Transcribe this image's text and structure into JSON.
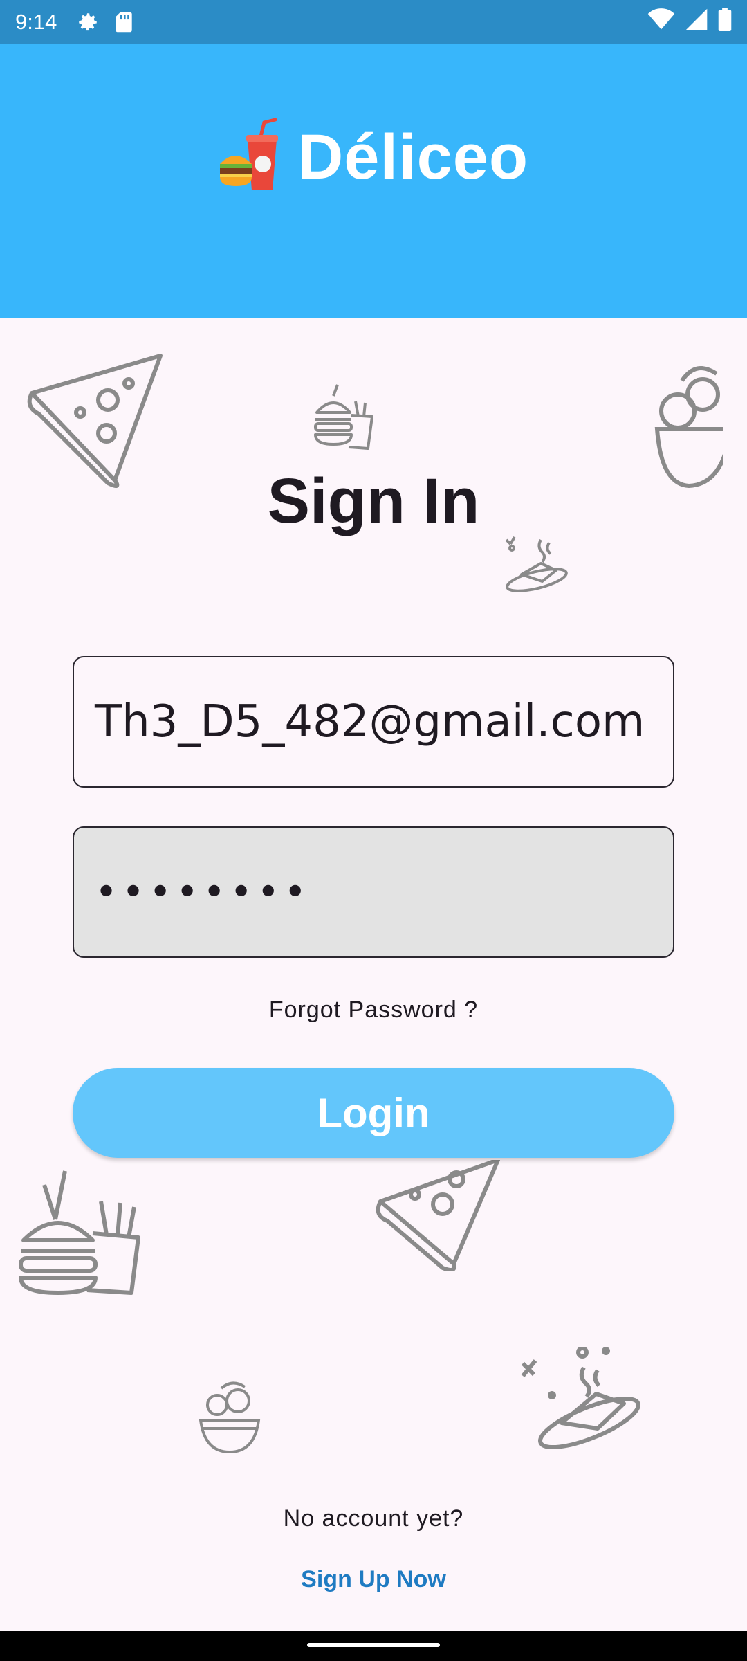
{
  "status_bar": {
    "time": "9:14",
    "icons": [
      "settings-icon",
      "sd-card-icon",
      "wifi-icon",
      "signal-icon",
      "battery-icon"
    ]
  },
  "header": {
    "logo_icon": "burger-drink-icon",
    "title": "Déliceo",
    "background": "#38b6fb"
  },
  "form": {
    "title": "Sign In",
    "email_value": "Th3_D5_482@gmail.com",
    "password_value": "••••••••",
    "forgot_label": "Forgot Password ?",
    "login_label": "Login"
  },
  "footer": {
    "no_account_text": "No account yet?",
    "signup_label": "Sign Up Now"
  },
  "colors": {
    "accent": "#38b6fb",
    "button": "#63c6fb",
    "link": "#1f7bc2",
    "status_bar": "#2b8cc6"
  },
  "decorations": [
    "pizza-icon",
    "burger-fries-icon",
    "salad-bowl-icon",
    "dish-icon"
  ]
}
